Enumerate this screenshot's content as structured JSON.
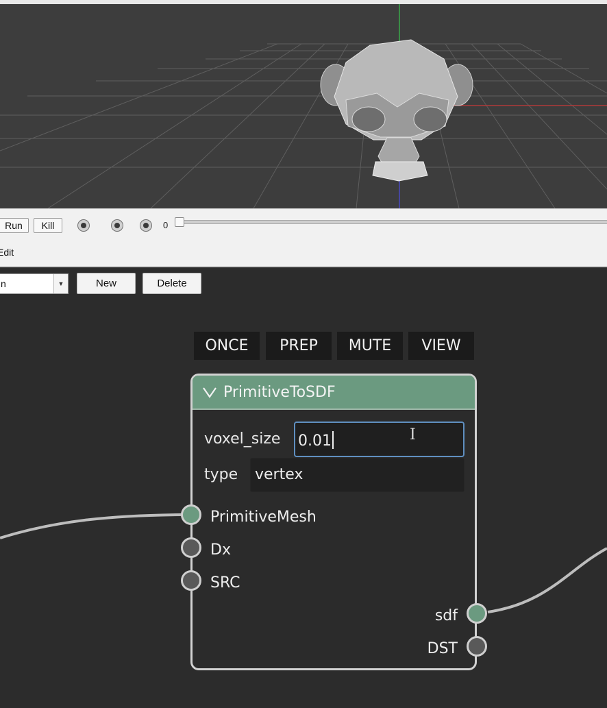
{
  "transport": {
    "run_label": "Run",
    "kill_label": "Kill",
    "frame": "0"
  },
  "menu": {
    "edit_label": "Edit"
  },
  "graph_controls": {
    "selector_value": "n",
    "new_label": "New",
    "delete_label": "Delete"
  },
  "flags": [
    "ONCE",
    "PREP",
    "MUTE",
    "VIEW"
  ],
  "node": {
    "title": "PrimitiveToSDF",
    "params": {
      "voxel_size": {
        "label": "voxel_size",
        "value": "0.01"
      },
      "type": {
        "label": "type",
        "value": "vertex"
      }
    },
    "inputs": [
      {
        "label": "PrimitiveMesh",
        "connected": true,
        "color": "#6b9a80"
      },
      {
        "label": "Dx",
        "connected": false,
        "color": "#595959"
      },
      {
        "label": "SRC",
        "connected": false,
        "color": "#595959"
      }
    ],
    "outputs": [
      {
        "label": "sdf",
        "connected": true,
        "color": "#6b9a80"
      },
      {
        "label": "DST",
        "connected": false,
        "color": "#595959"
      }
    ]
  },
  "colors": {
    "node_header": "#6b9a80",
    "editor_bg": "#2c2c2c",
    "viewport_bg": "#3d3d3d",
    "focus_border": "#5f8fc0"
  }
}
